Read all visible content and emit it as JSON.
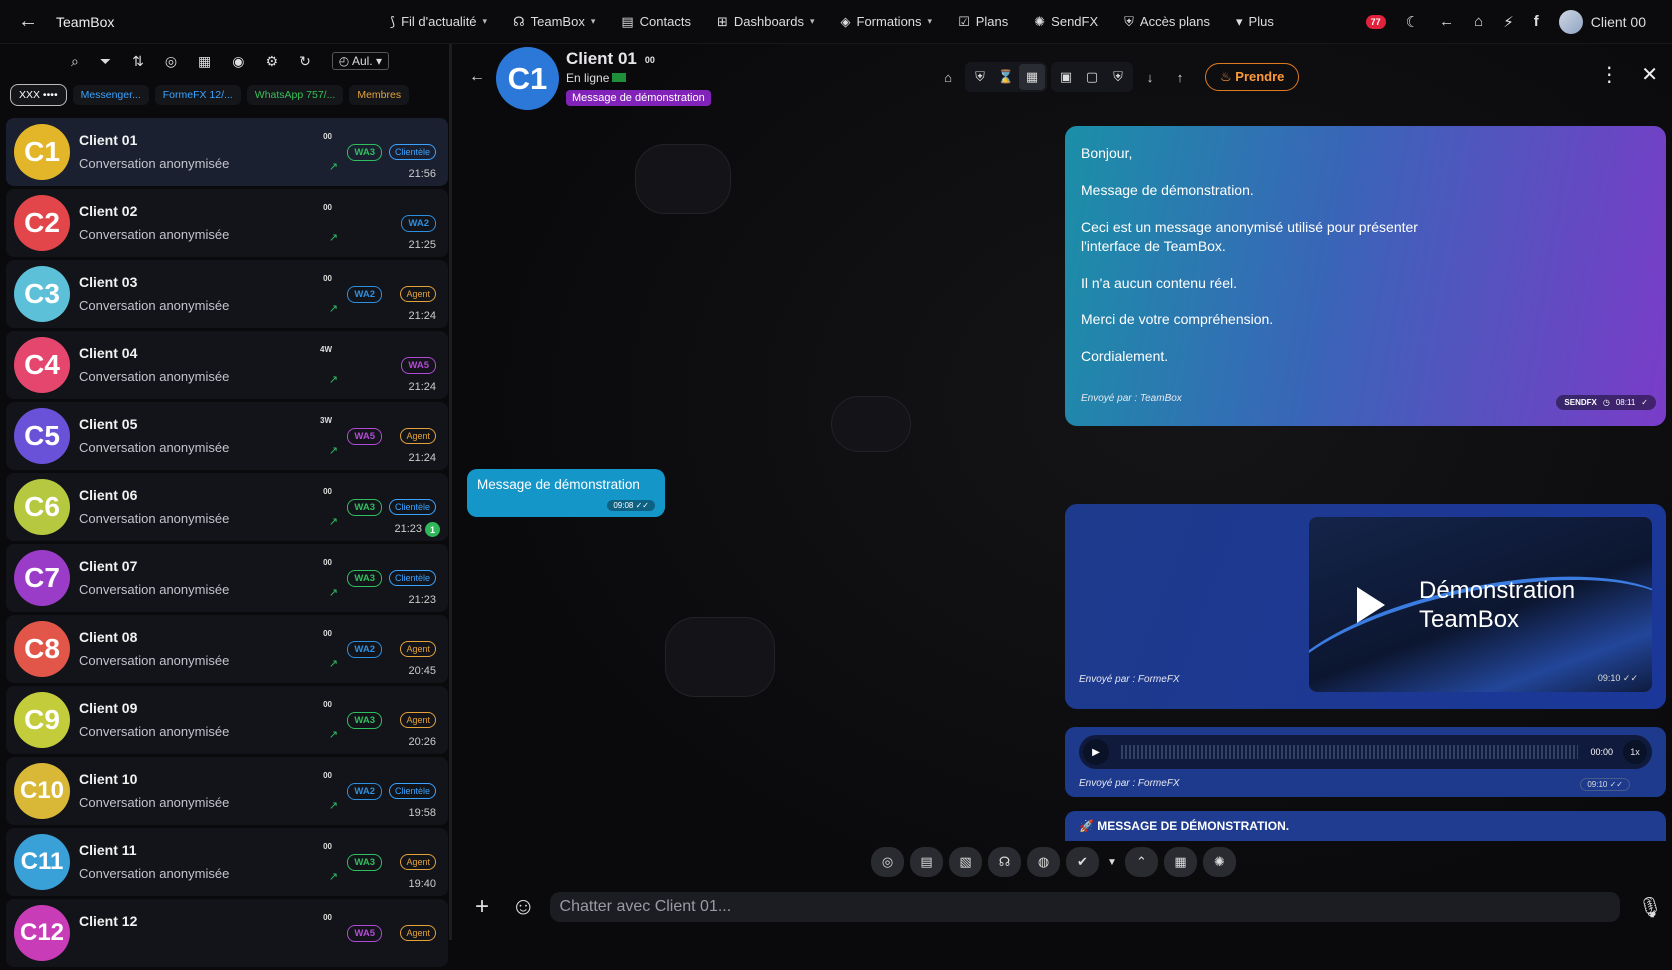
{
  "topbar": {
    "back_label": "←",
    "brand": "TeamBox",
    "nav": [
      {
        "label": "Fil d'actualité",
        "icon": "rss-icon",
        "glyph": "⟆",
        "chevron": true
      },
      {
        "label": "TeamBox",
        "icon": "headset-icon",
        "glyph": "☊",
        "chevron": true
      },
      {
        "label": "Contacts",
        "icon": "document-icon",
        "glyph": "▤",
        "chevron": false
      },
      {
        "label": "Dashboards",
        "icon": "dashboard-icon",
        "glyph": "⊞",
        "chevron": true
      },
      {
        "label": "Formations",
        "icon": "graduation-icon",
        "glyph": "◈",
        "chevron": true
      },
      {
        "label": "Plans",
        "icon": "check-square-icon",
        "glyph": "☑",
        "chevron": false
      },
      {
        "label": "SendFX",
        "icon": "megaphone-icon",
        "glyph": "✺",
        "chevron": false
      },
      {
        "label": "Accès plans",
        "icon": "shield-user-icon",
        "glyph": "⛨",
        "chevron": false
      },
      {
        "label": "Plus",
        "icon": "chevron-down-icon",
        "glyph": "▾",
        "chevron": false
      }
    ],
    "notif_count": "77",
    "user_name": "Client 00"
  },
  "sidebar": {
    "tools_select": "Aul.",
    "filters": [
      "XXX ••••",
      "Messenger...",
      "FormeFX 12/...",
      "WhatsApp 757/...",
      "Membres"
    ],
    "conversations": [
      {
        "initials": "C1",
        "name": "Client 01",
        "preview": "Conversation anonymisée",
        "count": "00",
        "wa": "WA3",
        "tag": "Clientèle",
        "time": "21:56",
        "color": "#e3b62a",
        "active": true
      },
      {
        "initials": "C2",
        "name": "Client 02",
        "preview": "Conversation anonymisée",
        "count": "00",
        "wa": "WA2",
        "tag": "",
        "time": "21:25",
        "color": "#e2464a"
      },
      {
        "initials": "C3",
        "name": "Client 03",
        "preview": "Conversation anonymisée",
        "count": "00",
        "wa": "WA2",
        "tag": "Agent",
        "time": "21:24",
        "color": "#5bc0d8"
      },
      {
        "initials": "C4",
        "name": "Client 04",
        "preview": "Conversation anonymisée",
        "count": "4W",
        "wa": "WA5",
        "tag": "",
        "time": "21:24",
        "color": "#e5466e"
      },
      {
        "initials": "C5",
        "name": "Client 05",
        "preview": "Conversation anonymisée",
        "count": "3W",
        "wa": "WA5",
        "tag": "Agent",
        "time": "21:24",
        "color": "#6a52d8"
      },
      {
        "initials": "C6",
        "name": "Client 06",
        "preview": "Conversation anonymisée",
        "count": "00",
        "wa": "WA3",
        "tag": "Clientèle",
        "time": "21:23",
        "color": "#b6c840",
        "unread": "1"
      },
      {
        "initials": "C7",
        "name": "Client 07",
        "preview": "Conversation anonymisée",
        "count": "00",
        "wa": "WA3",
        "tag": "Clientèle",
        "time": "21:23",
        "color": "#9a3cc8"
      },
      {
        "initials": "C8",
        "name": "Client 08",
        "preview": "Conversation anonymisée",
        "count": "00",
        "wa": "WA2",
        "tag": "Agent",
        "time": "20:45",
        "color": "#e2564a"
      },
      {
        "initials": "C9",
        "name": "Client 09",
        "preview": "Conversation anonymisée",
        "count": "00",
        "wa": "WA3",
        "tag": "Agent",
        "time": "20:26",
        "color": "#c3cc3a"
      },
      {
        "initials": "C10",
        "name": "Client 10",
        "preview": "Conversation anonymisée",
        "count": "00",
        "wa": "WA2",
        "tag": "Clientèle",
        "time": "19:58",
        "color": "#d8b836"
      },
      {
        "initials": "C11",
        "name": "Client 11",
        "preview": "Conversation anonymisée",
        "count": "00",
        "wa": "WA3",
        "tag": "Agent",
        "time": "19:40",
        "color": "#3aa0d8"
      },
      {
        "initials": "C12",
        "name": "Client 12",
        "preview": "",
        "count": "00",
        "wa": "WA5",
        "tag": "Agent",
        "time": "",
        "color": "#c83cb8"
      }
    ]
  },
  "chat": {
    "initials": "C1",
    "name": "Client 01",
    "count": "00",
    "status": "En ligne",
    "tag": "Message de démonstration",
    "take_button": "Prendre",
    "messages": {
      "big": {
        "lines": [
          "Bonjour,",
          "Message de démonstration.",
          "Ceci est un message anonymisé utilisé pour présenter l'interface de TeamBox.",
          "Il n'a aucun contenu réel.",
          "Merci de votre compréhension.",
          "Cordialement."
        ],
        "sent_by": "Envoyé par : TeamBox",
        "channel": "SENDFX",
        "time": "08:11"
      },
      "out": {
        "text": "Message de démonstration",
        "time": "09:08"
      },
      "video": {
        "title_line1": "Démonstration",
        "title_line2": "TeamBox",
        "sent_by": "Envoyé par : FormeFX",
        "time": "09:10"
      },
      "audio": {
        "duration": "00:00",
        "speed": "1x",
        "sent_by": "Envoyé par : FormeFX",
        "time": "09:10"
      },
      "banner": "🚀 MESSAGE DE DÉMONSTRATION."
    },
    "composer_placeholder": "Chatter avec Client 01..."
  }
}
